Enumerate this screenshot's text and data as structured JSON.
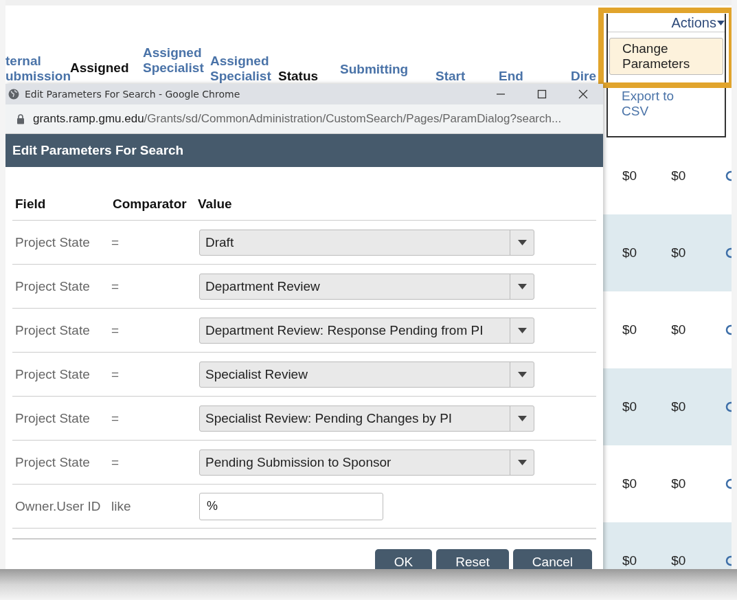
{
  "background_table": {
    "columns": [
      {
        "lines": [
          "ternal",
          "ubmission"
        ],
        "link": true
      },
      {
        "lines": [
          "Assigned"
        ],
        "link": false
      },
      {
        "lines": [
          "Assigned",
          "Specialist"
        ],
        "link": true
      },
      {
        "lines": [
          "Assigned",
          "Specialist"
        ],
        "link": true
      },
      {
        "lines": [
          "Status"
        ],
        "link": false
      },
      {
        "lines": [
          "Submitting"
        ],
        "link": true
      },
      {
        "lines": [
          "Start"
        ],
        "link": true
      },
      {
        "lines": [
          "End"
        ],
        "link": true
      },
      {
        "lines": [
          "Dire"
        ],
        "link": true
      }
    ],
    "rows": [
      {
        "cells": [
          "$0",
          "$0"
        ]
      },
      {
        "cells": [
          "$0",
          "$0"
        ]
      },
      {
        "cells": [
          "$0",
          "$0"
        ]
      },
      {
        "cells": [
          "$0",
          "$0"
        ]
      },
      {
        "cells": [
          "$0",
          "$0"
        ]
      },
      {
        "cells": [
          "$0",
          "$0"
        ]
      }
    ]
  },
  "actions_menu": {
    "label": "Actions",
    "items": [
      {
        "label": "Change Parameters",
        "selected": true
      },
      {
        "label": "Export to CSV",
        "selected": false
      }
    ]
  },
  "browser_window": {
    "title": "Edit Parameters For Search - Google Chrome",
    "url_host": "grants.ramp.gmu.edu",
    "url_path": "/Grants/sd/CommonAdministration/CustomSearch/Pages/ParamDialog?search..."
  },
  "dialog": {
    "title": "Edit Parameters For Search",
    "columns": [
      "Field",
      "Comparator",
      "Value"
    ],
    "rows": [
      {
        "field": "Project State",
        "comparator": "=",
        "kind": "select",
        "value": "Draft"
      },
      {
        "field": "Project State",
        "comparator": "=",
        "kind": "select",
        "value": "Department Review"
      },
      {
        "field": "Project State",
        "comparator": "=",
        "kind": "select",
        "value": "Department Review: Response Pending from PI"
      },
      {
        "field": "Project State",
        "comparator": "=",
        "kind": "select",
        "value": "Specialist Review"
      },
      {
        "field": "Project State",
        "comparator": "=",
        "kind": "select",
        "value": "Specialist Review: Pending Changes by PI"
      },
      {
        "field": "Project State",
        "comparator": "=",
        "kind": "select",
        "value": "Pending Submission to Sponsor"
      },
      {
        "field": "Owner.User ID",
        "comparator": "like",
        "kind": "text",
        "value": "%"
      }
    ],
    "buttons": [
      "OK",
      "Reset",
      "Cancel"
    ]
  }
}
